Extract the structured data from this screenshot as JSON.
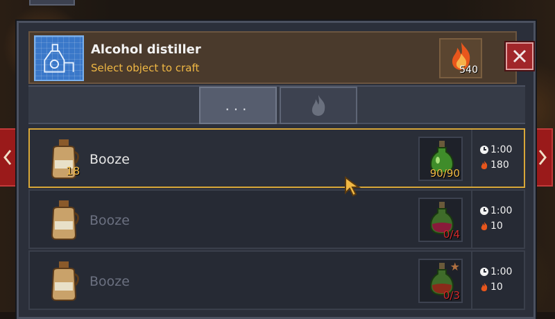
{
  "window": {
    "title": "Alcohol distiller",
    "subtitle": "Select object to craft",
    "fuel": "540",
    "icon": "blueprint-distiller-icon"
  },
  "tabs": [
    {
      "label": "...",
      "icon": "more-dots-icon",
      "active": true
    },
    {
      "label": "",
      "icon": "flame-icon",
      "active": false
    }
  ],
  "recipes": [
    {
      "name": "Booze",
      "owned": "18",
      "ingredient_count": "90/90",
      "ingredient_ok": true,
      "ingredient_color": "#3f8c2a",
      "time": "1:00",
      "fuel": "180",
      "selected": true,
      "star": false
    },
    {
      "name": "Booze",
      "owned": "",
      "ingredient_count": "0/4",
      "ingredient_ok": false,
      "ingredient_color": "#8a1a3a",
      "time": "1:00",
      "fuel": "10",
      "selected": false,
      "star": false
    },
    {
      "name": "Booze",
      "owned": "",
      "ingredient_count": "0/3",
      "ingredient_ok": false,
      "ingredient_color": "#8a2a1a",
      "time": "1:00",
      "fuel": "10",
      "selected": false,
      "star": true
    }
  ],
  "colors": {
    "accent_gold": "#f0b844",
    "close_red": "#a1262a",
    "error_red": "#d22a2a",
    "selected_border": "#d8a738"
  }
}
